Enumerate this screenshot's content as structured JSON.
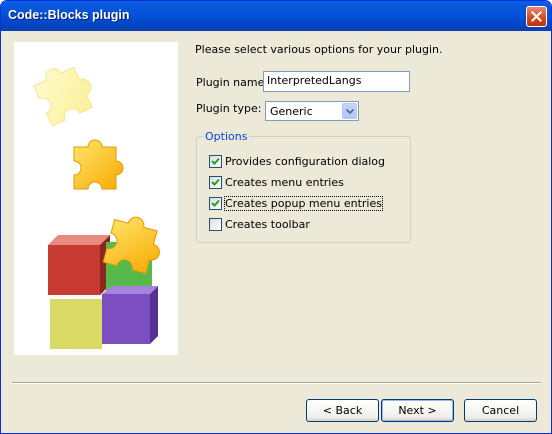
{
  "window": {
    "title": "Code::Blocks plugin"
  },
  "intro": "Please select various options for your plugin.",
  "plugin_name": {
    "label": "Plugin name:",
    "value": "InterpretedLangs"
  },
  "plugin_type": {
    "label": "Plugin type:",
    "value": "Generic"
  },
  "options": {
    "legend": "Options",
    "items": [
      {
        "label": "Provides configuration dialog",
        "checked": true
      },
      {
        "label": "Creates menu entries",
        "checked": true
      },
      {
        "label": "Creates popup menu entries",
        "checked": true,
        "focused": true
      },
      {
        "label": "Creates toolbar",
        "checked": false
      }
    ]
  },
  "buttons": {
    "back": "< Back",
    "next": "Next >",
    "cancel": "Cancel"
  },
  "colors": {
    "title_bar": "#0353d8",
    "accent": "#0046d5",
    "check_green": "#21a121"
  },
  "icons": {
    "close": "close-icon",
    "art": "puzzle-blocks-art"
  }
}
